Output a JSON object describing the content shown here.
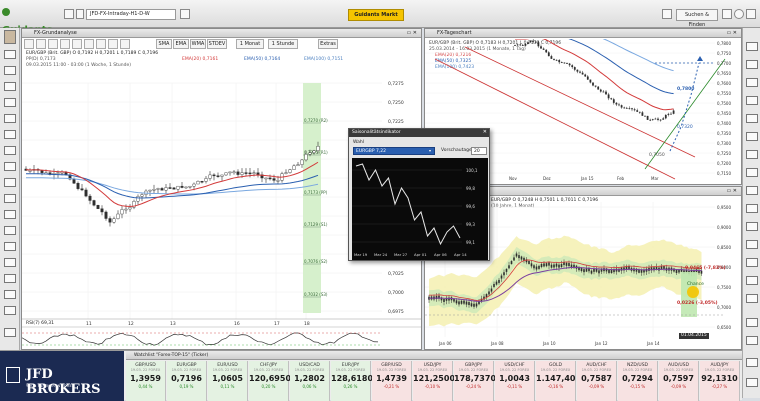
{
  "app": {
    "logo": "Guidants",
    "tab_title": "JFD-FX-Intraday-H1-D-W",
    "primary_button": "Guidants Markt",
    "search_button": "Suchen & Finden"
  },
  "left_panel": {
    "title": "FX-Grundanalyse",
    "toolbar": [
      "SMA",
      "EMA",
      "WMA",
      "STDEV",
      "1 Monat",
      "1 Stunde",
      "Extras"
    ],
    "legend": {
      "line1": "EUR/GBP (Brit. GBP)  O 0,7192  H 0,7201  L 0,7189  C 0,7196",
      "line2": "PP(D)  0,7173",
      "line3": "09.03.2015 11:00 - 03:00 (1 Woche, 1 Stunde)",
      "ema20": "EMA(20)  0,7161",
      "ema50": "EMA(50)  0,7164",
      "ema100": "EMA(100)  0,7151"
    },
    "price_axis": [
      "0,7275",
      "0,7250",
      "0,7225",
      "0,7200",
      "0,7175",
      "0,7150",
      "0,7125",
      "0,7100",
      "0,7075",
      "0,7050",
      "0,7025",
      "0,7000",
      "0,6975"
    ],
    "time_axis": [
      "11",
      "12",
      "13",
      "16",
      "17",
      "18"
    ],
    "fib_levels": [
      {
        "value": "0,7270 (R2)"
      },
      {
        "value": "0,7225 (R1)"
      },
      {
        "value": "0,7173 (PP)"
      },
      {
        "value": "0,7129 (S1)"
      },
      {
        "value": "0,7076 (S2)"
      },
      {
        "value": "0,7032 (S3)"
      }
    ],
    "rsi_label": "RSI(7)  69,31"
  },
  "right_top_panel": {
    "title": "FX-Tageschart",
    "legend": {
      "line1": "EUR/GBP (Brit. GBP)  O 0,7183  H 0,7201  L 0,7170  C 0,7196",
      "line2": "25.03.2014 - 16.03.2015 (1 Monate, 1 Tag)",
      "ema20": "EMA(20)  0,7216",
      "ema50": "EMA(50)  0,7325",
      "ema100": "EMA(100)  0,7423"
    },
    "price_axis": [
      "0,7800",
      "0,7750",
      "0,7700",
      "0,7650",
      "0,7600",
      "0,7550",
      "0,7500",
      "0,7450",
      "0,7400",
      "0,7350",
      "0,7300",
      "0,7250",
      "0,7200",
      "0,7150"
    ],
    "time_axis": [
      "Nov",
      "Dez",
      "Jan 15",
      "Feb",
      "Mar"
    ],
    "target_upper": "0,7800",
    "target_mid": "0,7320",
    "low_mark": "0,7050"
  },
  "right_bottom_panel": {
    "legend": {
      "line1": "EUR/GBP  O 0,7248  H 0,7501  L 0,7011  C 0,7196",
      "line2": "(10 Jahre, 1 Monat)"
    },
    "price_axis": [
      "0,9500",
      "0,9000",
      "0,8500",
      "0,8000",
      "0,7500",
      "0,7000",
      "0,6500"
    ],
    "time_axis": [
      "Jan 06",
      "Jan 08",
      "Jan 10",
      "Jan 12",
      "Jan 14"
    ],
    "annot1": "0,0465 (-7,83%)",
    "annot2": "0,0226 (-3,05%)",
    "annot3": "Chance",
    "date_tag": "01.04.2015"
  },
  "dialog": {
    "title": "Saisonalitätsindikator",
    "label_wahl": "Wahl",
    "select_value": "EURGBP 7,22",
    "label_vorschau": "Vorschautage",
    "vorschau_value": "20",
    "y_axis": [
      "100,1",
      "99,8",
      "99,6",
      "99,3",
      "99,1"
    ],
    "x_axis": [
      "Mar 19",
      "Mar 24",
      "Mar 27",
      "Apr 01",
      "Apr 06",
      "Apr 14"
    ]
  },
  "ticker": {
    "header": "Watchlist \"Forex-TOP-15\" (Ticker)",
    "broker_name": "JFD BROKERS",
    "broker_sub": "YOUR PARTNER IN FOREX",
    "items": [
      {
        "sym": "GBP/USD",
        "date": "19.03. 22 FOREX",
        "val": "1,3959",
        "chg": "0,44 %",
        "dir": "up"
      },
      {
        "sym": "EUR/GBP",
        "date": "19.03. 22 FOREX",
        "val": "0,7196",
        "chg": "0,19 %",
        "dir": "up"
      },
      {
        "sym": "EUR/USD",
        "date": "19.03. 22 FOREX",
        "val": "1,0605",
        "chg": "0,11 %",
        "dir": "up"
      },
      {
        "sym": "CHF/JPY",
        "date": "19.03. 22 FOREX",
        "val": "120,6950",
        "chg": "0,20 %",
        "dir": "up"
      },
      {
        "sym": "USD/CAD",
        "date": "19.03. 22 FOREX",
        "val": "1,2802",
        "chg": "0,06 %",
        "dir": "up"
      },
      {
        "sym": "EUR/JPY",
        "date": "19.03. 22 FOREX",
        "val": "128,6180",
        "chg": "0,26 %",
        "dir": "up"
      },
      {
        "sym": "GBP/USD",
        "date": "19.03. 22 FOREX",
        "val": "1,4739",
        "chg": "-0,21 %",
        "dir": "down"
      },
      {
        "sym": "USD/JPY",
        "date": "19.03. 22 FOREX",
        "val": "121,2500",
        "chg": "-0,10 %",
        "dir": "down"
      },
      {
        "sym": "GBP/JPY",
        "date": "19.03. 22 FOREX",
        "val": "178,7370",
        "chg": "-0,24 %",
        "dir": "down"
      },
      {
        "sym": "USD/CHF",
        "date": "19.03. 22 FOREX",
        "val": "1,0043",
        "chg": "-0,11 %",
        "dir": "down"
      },
      {
        "sym": "GOLD",
        "date": "19.03. 22 FOREX",
        "val": "1.147,40",
        "chg": "-0,16 %",
        "dir": "down"
      },
      {
        "sym": "AUD/CHF",
        "date": "19.03. 22 FOREX",
        "val": "0,7587",
        "chg": "-0,09 %",
        "dir": "down"
      },
      {
        "sym": "NZD/USD",
        "date": "19.03. 22 FOREX",
        "val": "0,7294",
        "chg": "-0,15 %",
        "dir": "down"
      },
      {
        "sym": "AUD/USD",
        "date": "19.03. 22 FOREX",
        "val": "0,7597",
        "chg": "-0,09 %",
        "dir": "down"
      },
      {
        "sym": "AUD/JPY",
        "date": "19.03. 22 FOREX",
        "val": "92,1310",
        "chg": "-0,27 %",
        "dir": "down"
      }
    ]
  },
  "colors": {
    "candle_up": "#2e2e2e",
    "candle_down": "#2e2e2e",
    "ema20": "#d33a3a",
    "ema50": "#2a5fb0",
    "ema100": "#7aa8e0",
    "green_zone": "#bfe8b0",
    "accent_yellow": "#f5c400",
    "brand_navy": "#1b2a52"
  }
}
